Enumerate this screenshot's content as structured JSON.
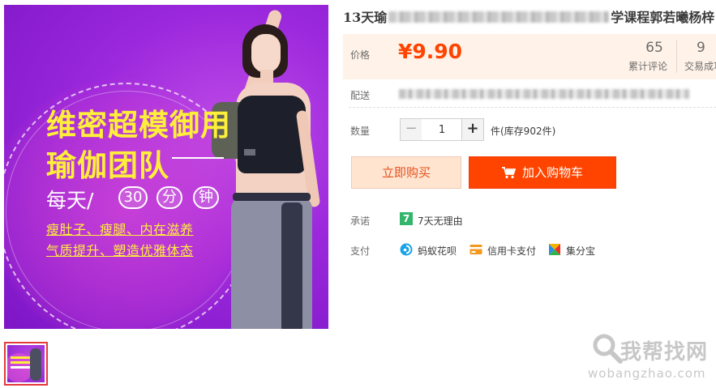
{
  "product": {
    "title_start": "13天瑜",
    "title_end": "学课程郭若曦杨梓"
  },
  "promo_image": {
    "line1": "维密超模御用",
    "line2": "瑜伽团队",
    "every": "每天/",
    "pill_1": "30",
    "pill_2": "分",
    "pill_3": "钟",
    "benefit_1": "瘦肚子、瘦腿、内在滋养",
    "benefit_2": "气质提升、塑造优雅体态"
  },
  "price": {
    "label": "价格",
    "value": "¥9.90"
  },
  "stats": {
    "reviews_count": "65",
    "reviews_label": "累计评论",
    "sales_count": "9",
    "sales_label": "交易成功"
  },
  "shipping": {
    "label": "配送"
  },
  "quantity": {
    "label": "数量",
    "minus": "−",
    "value": "1",
    "plus": "+",
    "stock": "件(库存902件)"
  },
  "actions": {
    "buy_now": "立即购买",
    "add_cart": "加入购物车"
  },
  "promise": {
    "label": "承诺",
    "icon_text": "7",
    "text": "7天无理由"
  },
  "payment": {
    "label": "支付",
    "methods": [
      {
        "name": "蚂蚁花呗",
        "icon": "huabei-icon"
      },
      {
        "name": "信用卡支付",
        "icon": "credit-card-icon"
      },
      {
        "name": "集分宝",
        "icon": "jifenbao-icon"
      }
    ]
  },
  "watermark": {
    "text": "我帮找网",
    "url": "wobangzhao.com"
  },
  "colors": {
    "price": "#ff4400",
    "cart_button": "#ff4400",
    "buy_button_bg": "#ffe4d0",
    "price_box_bg": "#fff2e8",
    "promo_yellow": "#ffef3a"
  }
}
